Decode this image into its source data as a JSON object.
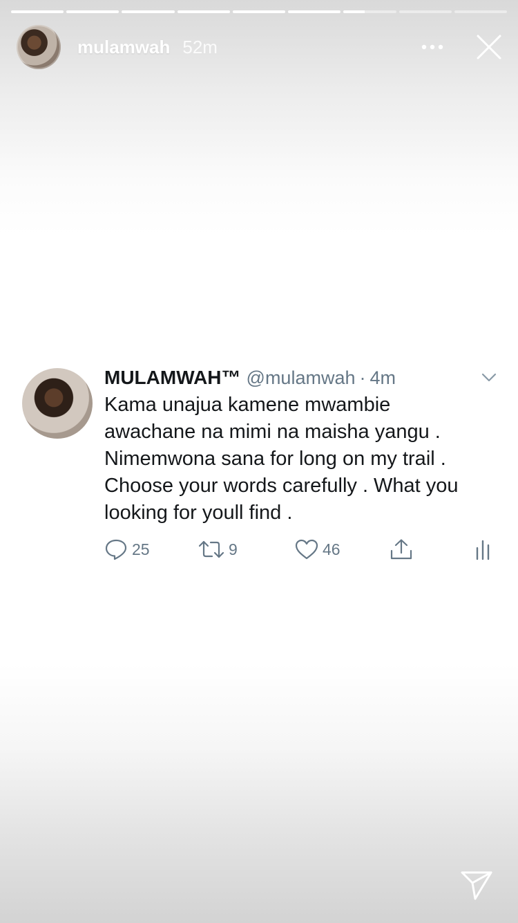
{
  "story": {
    "progress": [
      1,
      1,
      1,
      1,
      1,
      1,
      0.4,
      0,
      0
    ],
    "username": "mulamwah",
    "time": "52m"
  },
  "tweet": {
    "display_name": "MULAMWAH™",
    "handle": "@mulamwah",
    "separator": "·",
    "time": "4m",
    "text_lines": [
      "Kama unajua kamene mwambie",
      "awachane na mimi na maisha yangu .",
      "Nimemwona sana for long on my trail .",
      "Choose your words carefully . What you",
      "looking for youll find ."
    ],
    "replies": "25",
    "retweets": "9",
    "likes": "46"
  },
  "icons": {
    "more": "more-horizontal-icon",
    "close": "close-icon",
    "chevron": "chevron-down-icon",
    "reply": "reply-icon",
    "retweet": "retweet-icon",
    "like": "heart-icon",
    "share": "share-icon",
    "analytics": "analytics-icon",
    "send": "send-icon"
  },
  "colors": {
    "tweet_text": "#14171a",
    "tweet_muted": "#657786",
    "story_text": "#ffffff"
  }
}
